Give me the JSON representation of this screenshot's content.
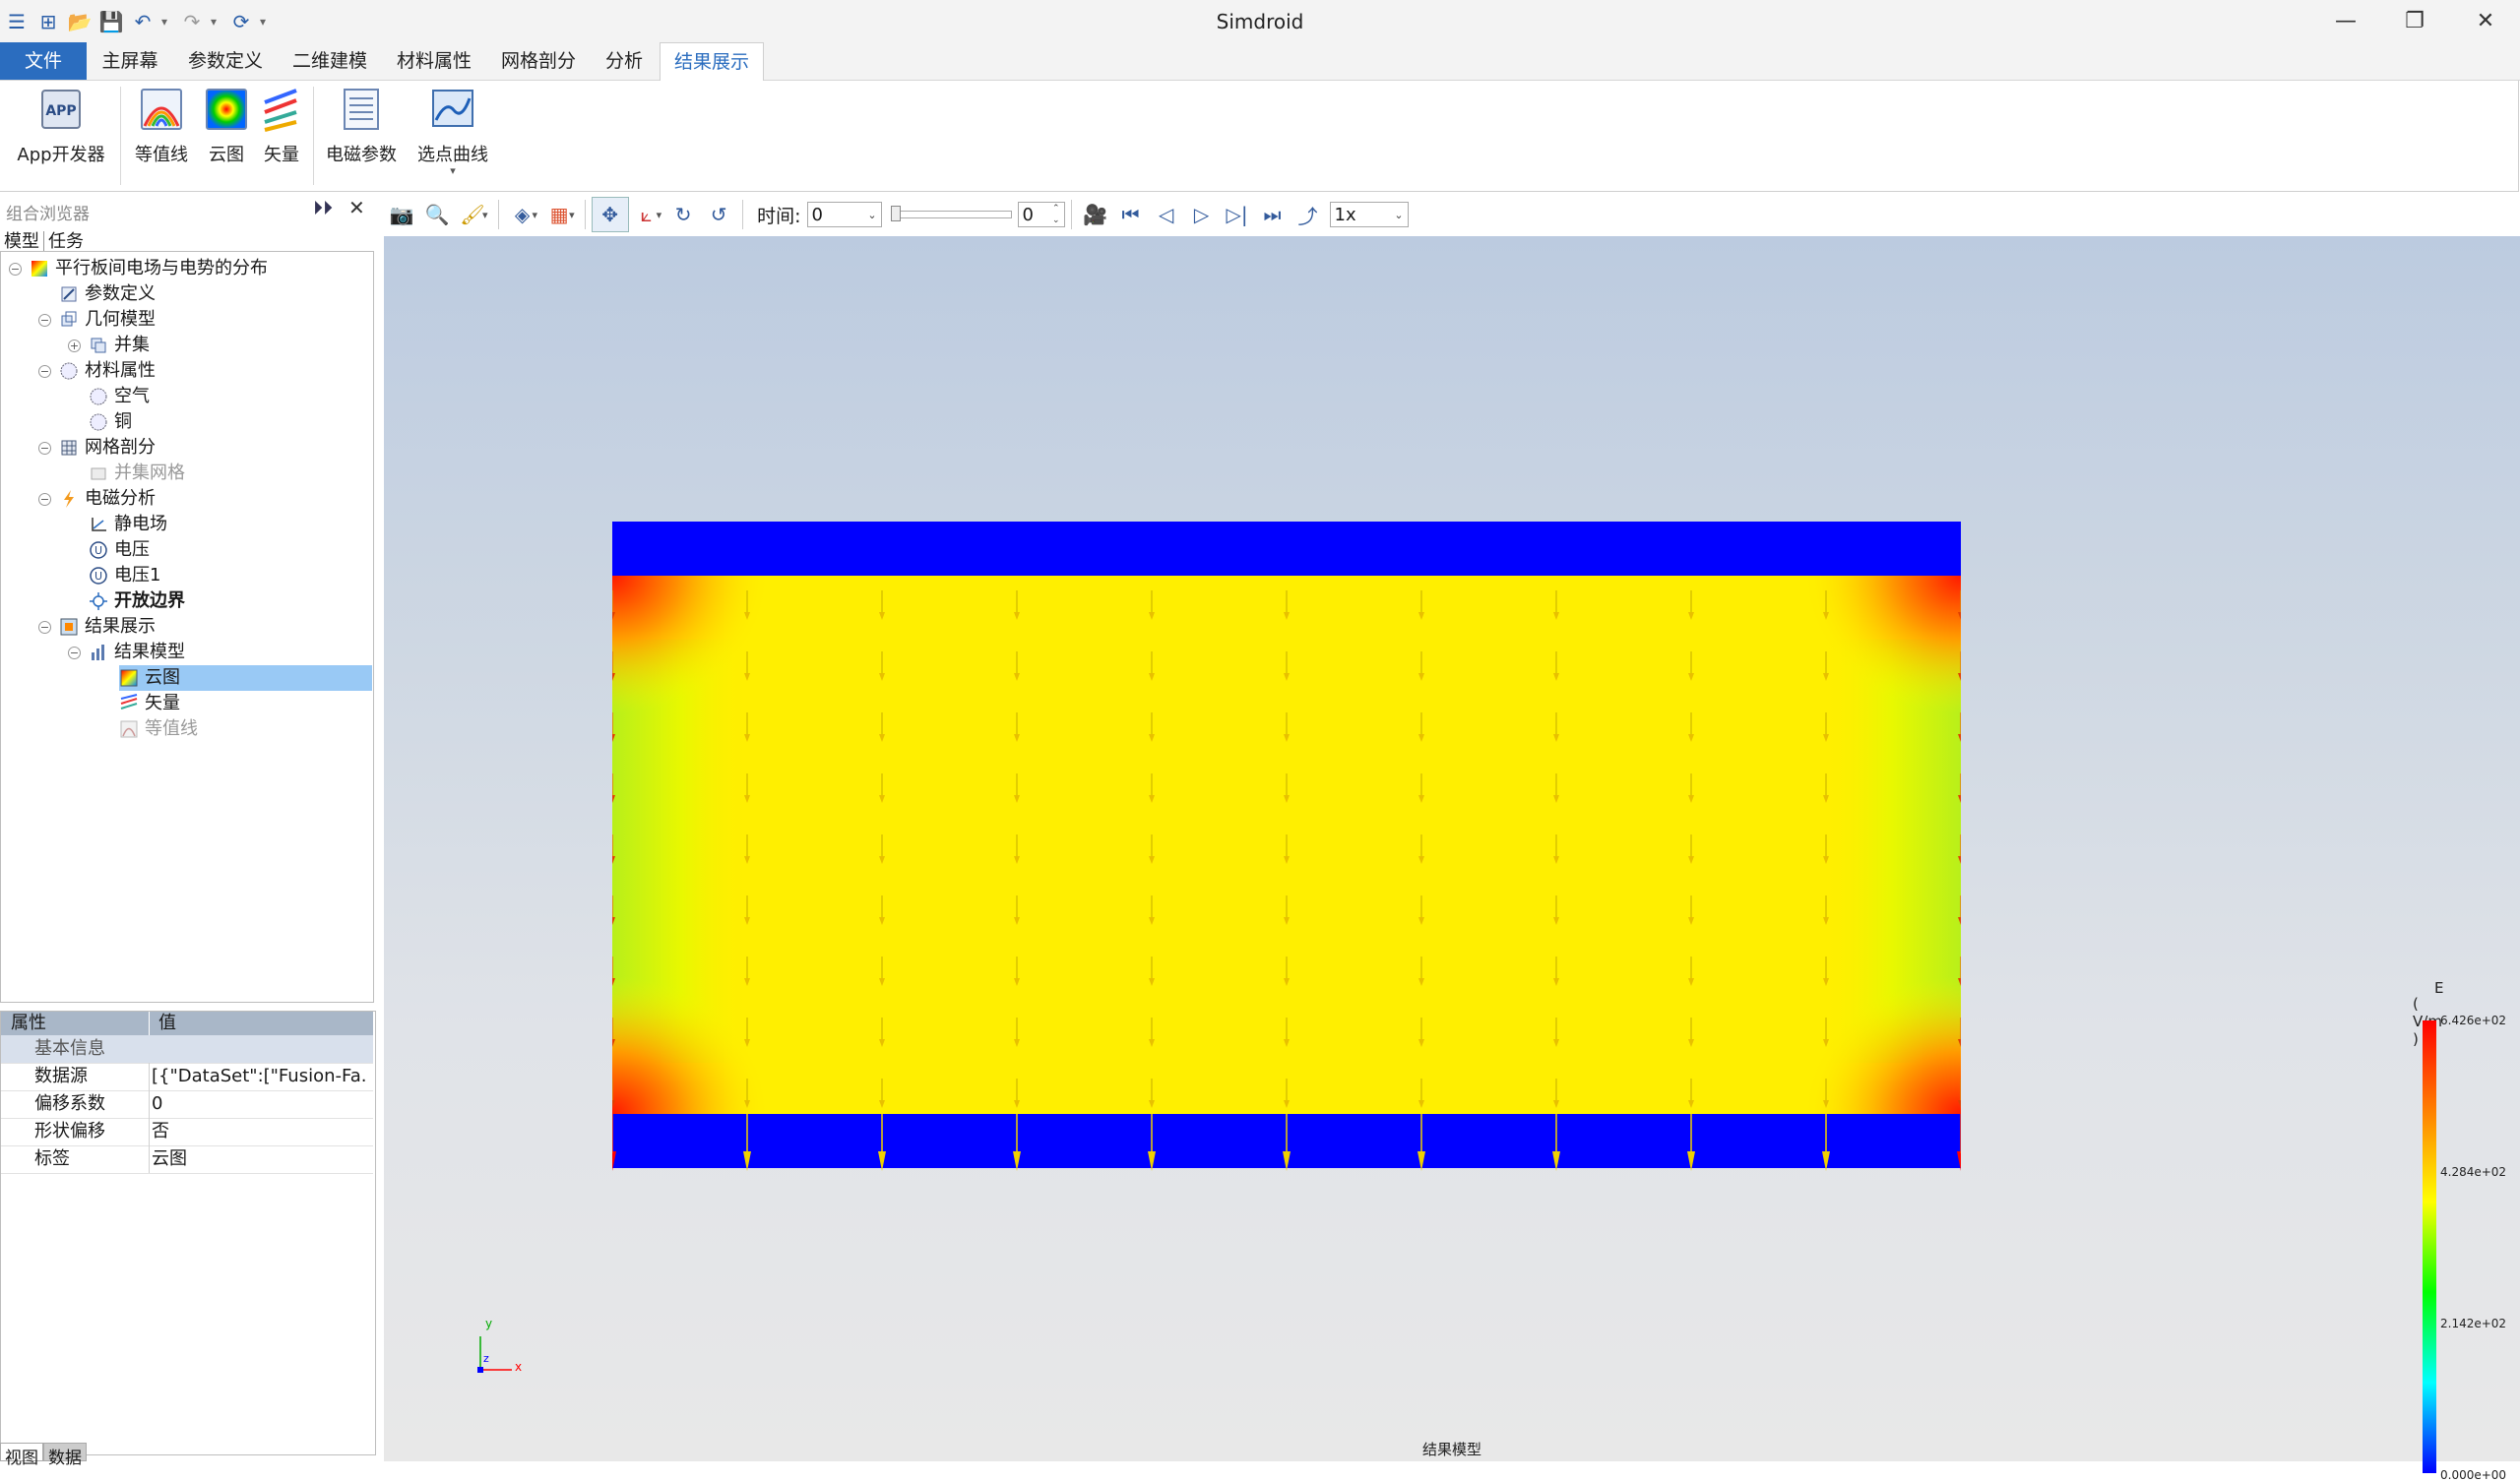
{
  "app": {
    "title": "Simdroid"
  },
  "window_controls": {
    "minimize": "—",
    "restore": "❐",
    "close": "✕"
  },
  "menu": {
    "tabs": [
      {
        "label": "文件"
      },
      {
        "label": "主屏幕"
      },
      {
        "label": "参数定义"
      },
      {
        "label": "二维建模"
      },
      {
        "label": "材料属性"
      },
      {
        "label": "网格剖分"
      },
      {
        "label": "分析"
      },
      {
        "label": "结果展示"
      }
    ],
    "active": "结果展示"
  },
  "ribbon": {
    "buttons": [
      {
        "label": "App开发器",
        "icon": "app-developer-icon"
      },
      {
        "label": "等值线",
        "icon": "contour-icon"
      },
      {
        "label": "云图",
        "icon": "cloud-map-icon"
      },
      {
        "label": "矢量",
        "icon": "vector-icon"
      },
      {
        "label": "电磁参数",
        "icon": "em-params-icon"
      },
      {
        "label": "选点曲线",
        "icon": "point-curve-icon"
      }
    ]
  },
  "browser": {
    "title": "组合浏览器",
    "tabs": [
      "模型",
      "任务"
    ],
    "tree": [
      {
        "label": "平行板间电场与电势的分布",
        "level": 0,
        "icon": "project-icon",
        "expanded": true
      },
      {
        "label": "参数定义",
        "level": 1,
        "icon": "params-icon"
      },
      {
        "label": "几何模型",
        "level": 1,
        "icon": "geometry-icon",
        "expanded": true
      },
      {
        "label": "并集",
        "level": 2,
        "icon": "union-icon",
        "collapsed": true
      },
      {
        "label": "材料属性",
        "level": 1,
        "icon": "material-icon",
        "expanded": true
      },
      {
        "label": "空气",
        "level": 2,
        "icon": "material-icon"
      },
      {
        "label": "铜",
        "level": 2,
        "icon": "material-icon"
      },
      {
        "label": "网格剖分",
        "level": 1,
        "icon": "mesh-icon",
        "expanded": true
      },
      {
        "label": "并集网格",
        "level": 2,
        "icon": "mesh-item-icon",
        "dim": true
      },
      {
        "label": "电磁分析",
        "level": 1,
        "icon": "em-analysis-icon",
        "expanded": true
      },
      {
        "label": "静电场",
        "level": 2,
        "icon": "electrostatic-icon"
      },
      {
        "label": "电压",
        "level": 2,
        "icon": "voltage-icon"
      },
      {
        "label": "电压1",
        "level": 2,
        "icon": "voltage-icon"
      },
      {
        "label": "开放边界",
        "level": 2,
        "icon": "open-boundary-icon",
        "bold": true
      },
      {
        "label": "结果展示",
        "level": 1,
        "icon": "results-icon",
        "expanded": true
      },
      {
        "label": "结果模型",
        "level": 2,
        "icon": "result-model-icon",
        "expanded": true
      },
      {
        "label": "云图",
        "level": 3,
        "icon": "cloud-map-icon",
        "selected": true
      },
      {
        "label": "矢量",
        "level": 3,
        "icon": "vector-icon"
      },
      {
        "label": "等值线",
        "level": 3,
        "icon": "contour-icon",
        "dim": true
      }
    ]
  },
  "properties": {
    "headers": [
      "属性",
      "值"
    ],
    "group": "基本信息",
    "rows": [
      {
        "key": "数据源",
        "value": "[{\"DataSet\":[\"Fusion-Fa..."
      },
      {
        "key": "偏移系数",
        "value": "0"
      },
      {
        "key": "形状偏移",
        "value": "否"
      },
      {
        "key": "标签",
        "value": "云图"
      }
    ]
  },
  "bottom_tabs": [
    "视图",
    "数据"
  ],
  "view_toolbar": {
    "time_label": "时间:",
    "time_value": "0",
    "frame_value": "0",
    "speed": "1x"
  },
  "viewport": {
    "status": "结果模型",
    "axes": {
      "x": "x",
      "y": "y",
      "z": "z"
    }
  },
  "colorbar": {
    "title": "E",
    "unit": "( V/m )",
    "ticks": [
      "6.426e+02",
      "4.284e+02",
      "2.142e+02",
      "0.000e+00"
    ],
    "colors": [
      "#ff0000",
      "#ff8000",
      "#ffff00",
      "#00ff00",
      "#00ffff",
      "#0000ff"
    ]
  },
  "colors": {
    "accent": "#2b6dbf",
    "selection": "#99c9f5",
    "plate": "#0000ff",
    "field": "#ffff00"
  }
}
